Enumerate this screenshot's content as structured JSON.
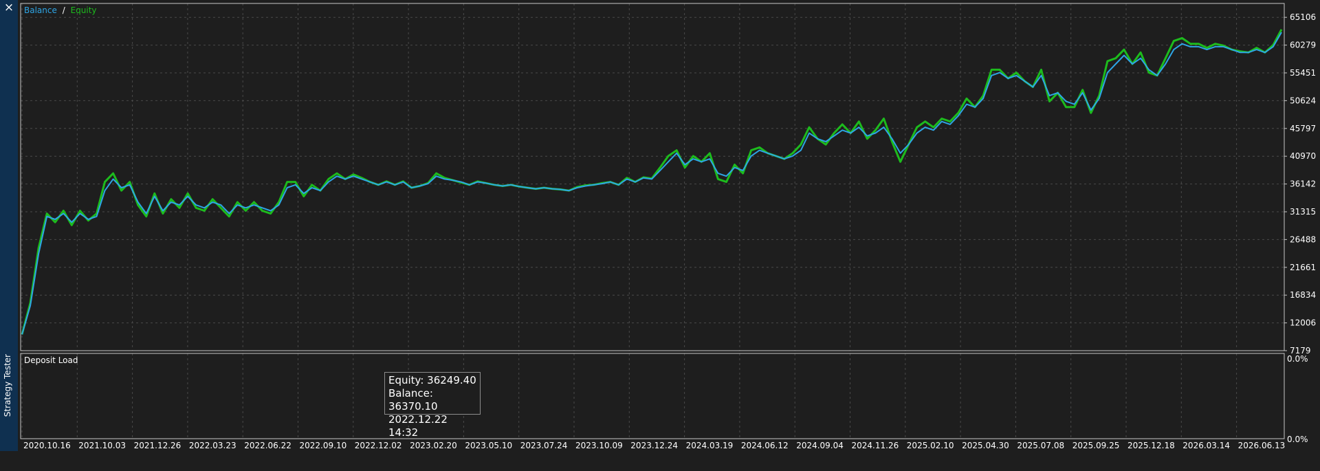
{
  "side_panel": {
    "close_icon": "×",
    "title": "Strategy Tester"
  },
  "legend": {
    "balance_label": "Balance",
    "separator": "/",
    "equity_label": "Equity"
  },
  "colors": {
    "background": "#1e1e1e",
    "balance": "#2ea5e5",
    "equity": "#1dbb1d",
    "grid": "#4a4a4a",
    "border": "#c8c8c8",
    "text": "#ffffff"
  },
  "deposit_panel": {
    "title": "Deposit Load",
    "top_value": "0.0%",
    "bottom_value": "0.0%"
  },
  "tooltip": {
    "equity": "Equity: 36249.40",
    "balance": "Balance: 36370.10",
    "time": "2022.12.22 14:32"
  },
  "chart_data": {
    "type": "line",
    "y_ticks": [
      "65106",
      "60279",
      "55451",
      "50624",
      "45797",
      "40970",
      "36142",
      "31315",
      "26488",
      "21661",
      "16834",
      "12006",
      "7179"
    ],
    "ylim": [
      7179,
      67519
    ],
    "x_ticks": [
      "2020.10.16",
      "2021.10.03",
      "2021.12.26",
      "2022.03.23",
      "2022.06.22",
      "2022.09.10",
      "2022.12.02",
      "2023.02.20",
      "2023.05.10",
      "2023.07.24",
      "2023.10.09",
      "2023.12.24",
      "2024.03.19",
      "2024.06.12",
      "2024.09.04",
      "2024.11.26",
      "2025.02.10",
      "2025.04.30",
      "2025.07.08",
      "2025.09.25",
      "2025.12.18",
      "2026.03.14",
      "2026.06.13"
    ],
    "grid": true,
    "legend_position": "top-left",
    "series": [
      {
        "name": "Balance",
        "values": [
          10000,
          15000,
          24000,
          30500,
          30000,
          31000,
          29500,
          31000,
          30000,
          30500,
          35000,
          37000,
          35500,
          36000,
          33000,
          31000,
          34000,
          31500,
          33000,
          32500,
          34000,
          32500,
          32000,
          33000,
          32500,
          31000,
          32500,
          32000,
          32500,
          32000,
          31500,
          32500,
          35500,
          36000,
          34500,
          35500,
          35000,
          36500,
          37500,
          37000,
          37500,
          37000,
          36500,
          36000,
          36500,
          36000,
          36500,
          35500,
          35800,
          36200,
          37500,
          37000,
          36800,
          36500,
          36000,
          36500,
          36300,
          36000,
          35800,
          36000,
          35700,
          35500,
          35300,
          35500,
          35300,
          35200,
          35000,
          35500,
          35800,
          36000,
          36200,
          36500,
          36000,
          37000,
          36500,
          37200,
          37000,
          38500,
          40000,
          41500,
          39500,
          40500,
          40000,
          40500,
          38000,
          37500,
          39000,
          38500,
          41000,
          42000,
          41500,
          41000,
          40500,
          41000,
          42000,
          45000,
          44000,
          43500,
          44500,
          45500,
          45000,
          46000,
          44500,
          45000,
          46000,
          44000,
          41500,
          43000,
          45000,
          46000,
          45500,
          47000,
          46500,
          48000,
          50000,
          49500,
          51000,
          55000,
          55500,
          54500,
          55000,
          54000,
          53000,
          55000,
          51500,
          52000,
          50500,
          50000,
          52000,
          49000,
          51000,
          55500,
          57000,
          58500,
          57000,
          58000,
          56000,
          55000,
          57000,
          59500,
          60500,
          60000,
          60000,
          59500,
          60000,
          60000,
          59500,
          59000,
          59000,
          59500,
          59000,
          60000,
          62500
        ]
      },
      {
        "name": "Equity",
        "values": [
          10000,
          15500,
          25000,
          31000,
          29500,
          31500,
          29000,
          31500,
          29800,
          31000,
          36500,
          38000,
          35000,
          36500,
          32500,
          30500,
          34500,
          31000,
          33500,
          32000,
          34500,
          32000,
          31500,
          33500,
          32000,
          30500,
          33000,
          31500,
          33000,
          31500,
          31000,
          33000,
          36500,
          36500,
          34000,
          36000,
          35000,
          37000,
          38000,
          37000,
          37800,
          37200,
          36500,
          36000,
          36600,
          36000,
          36600,
          35500,
          35800,
          36300,
          38000,
          37200,
          36800,
          36400,
          36000,
          36600,
          36300,
          36000,
          35800,
          36000,
          35700,
          35500,
          35300,
          35500,
          35300,
          35200,
          35000,
          35600,
          35900,
          36000,
          36300,
          36500,
          36000,
          37200,
          36500,
          37300,
          37100,
          39000,
          41000,
          42000,
          39000,
          41000,
          40000,
          41500,
          37000,
          36500,
          39500,
          38000,
          42000,
          42500,
          41500,
          41000,
          40500,
          41500,
          43000,
          46000,
          44000,
          43000,
          45000,
          46500,
          45000,
          47000,
          44000,
          45500,
          47500,
          43500,
          40000,
          43000,
          46000,
          47000,
          46000,
          47500,
          47000,
          48500,
          51000,
          49500,
          51500,
          56000,
          56000,
          54500,
          55500,
          54000,
          53000,
          56000,
          50500,
          52000,
          49500,
          49500,
          52500,
          48500,
          51500,
          57500,
          58000,
          59500,
          57000,
          59000,
          55500,
          55000,
          58000,
          61000,
          61500,
          60500,
          60500,
          59800,
          60500,
          60200,
          59500,
          59200,
          59000,
          59800,
          59000,
          60300,
          63000
        ]
      }
    ]
  }
}
